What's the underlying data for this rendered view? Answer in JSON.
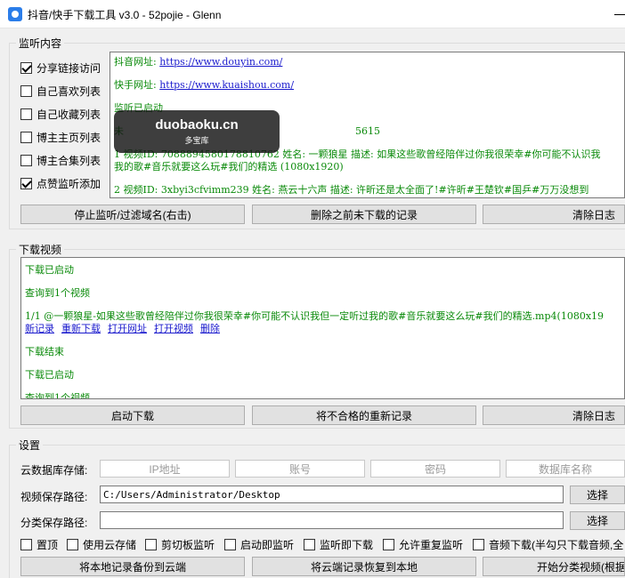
{
  "window": {
    "title": "抖音/快手下载工具 v3.0 - 52pojie - Glenn"
  },
  "monitor": {
    "group_label": "监听内容",
    "checkboxes": [
      {
        "label": "分享链接访问",
        "checked": true
      },
      {
        "label": "自己喜欢列表",
        "checked": false
      },
      {
        "label": "自己收藏列表",
        "checked": false
      },
      {
        "label": "博主主页列表",
        "checked": false
      },
      {
        "label": "博主合集列表",
        "checked": false
      },
      {
        "label": "点赞监听添加",
        "checked": true
      }
    ],
    "log": {
      "douyin_label": "抖音网址:",
      "douyin_url": "https://www.douyin.com/",
      "kuaishou_label": "快手网址:",
      "kuaishou_url": "https://www.kuaishou.com/",
      "started": "监听已启动",
      "line_partial": "未",
      "line_partial_tail": "5615",
      "item1_line1": "1 视频ID: 7088894580178810762 姓名: 一颗狼星 描述: 如果这些歌曾经陪伴过你我很荣幸#你可能不认识我",
      "item1_line2": "我的歌#音乐就要这么玩#我们的精选 (1080x1920)",
      "item2": "2 视频ID: 3xbyi3cfvimm239 姓名: 燕云十六声 描述: 许昕还是太全面了!#许昕#王楚钦#国乒#万万没想到"
    },
    "buttons": {
      "stop": "停止监听/过滤域名(右击)",
      "delete_undownloaded": "删除之前未下载的记录",
      "clear_log": "清除日志"
    }
  },
  "download": {
    "group_label": "下载视频",
    "log": {
      "started": "下载已启动",
      "found": "查询到1个视频",
      "item": "1/1 @一颗狼星-如果这些歌曾经陪伴过你我很荣幸#你可能不认识我但一定听过我的歌#音乐就要这么玩#我们的精选.mp4(1080x19",
      "links": [
        "新记录",
        "重新下载",
        "打开网址",
        "打开视频",
        "删除"
      ],
      "finished": "下载结束",
      "started2": "下载已启动",
      "found2": "查询到1个视频"
    },
    "buttons": {
      "start": "启动下载",
      "redownload": "将不合格的重新记录",
      "clear_log": "清除日志"
    }
  },
  "settings": {
    "group_label": "设置",
    "cloud_label": "云数据库存储:",
    "cloud_placeholders": [
      "IP地址",
      "账号",
      "密码",
      "数据库名称"
    ],
    "video_path_label": "视频保存路径:",
    "video_path_value": "C:/Users/Administrator/Desktop",
    "category_path_label": "分类保存路径:",
    "category_path_value": "",
    "choose_button": "选择",
    "options": [
      {
        "label": "置顶",
        "checked": false
      },
      {
        "label": "使用云存储",
        "checked": false
      },
      {
        "label": "剪切板监听",
        "checked": false
      },
      {
        "label": "启动即监听",
        "checked": false
      },
      {
        "label": "监听即下载",
        "checked": false
      },
      {
        "label": "允许重复监听",
        "checked": false
      },
      {
        "label": "音频下载(半勾只下载音频,全",
        "checked": false
      }
    ],
    "buttons": {
      "backup": "将本地记录备份到云端",
      "restore": "将云端记录恢复到本地",
      "classify": "开始分类视频(根据"
    }
  },
  "watermark": {
    "domain": "duobaoku.cn",
    "name": "多宝库"
  }
}
